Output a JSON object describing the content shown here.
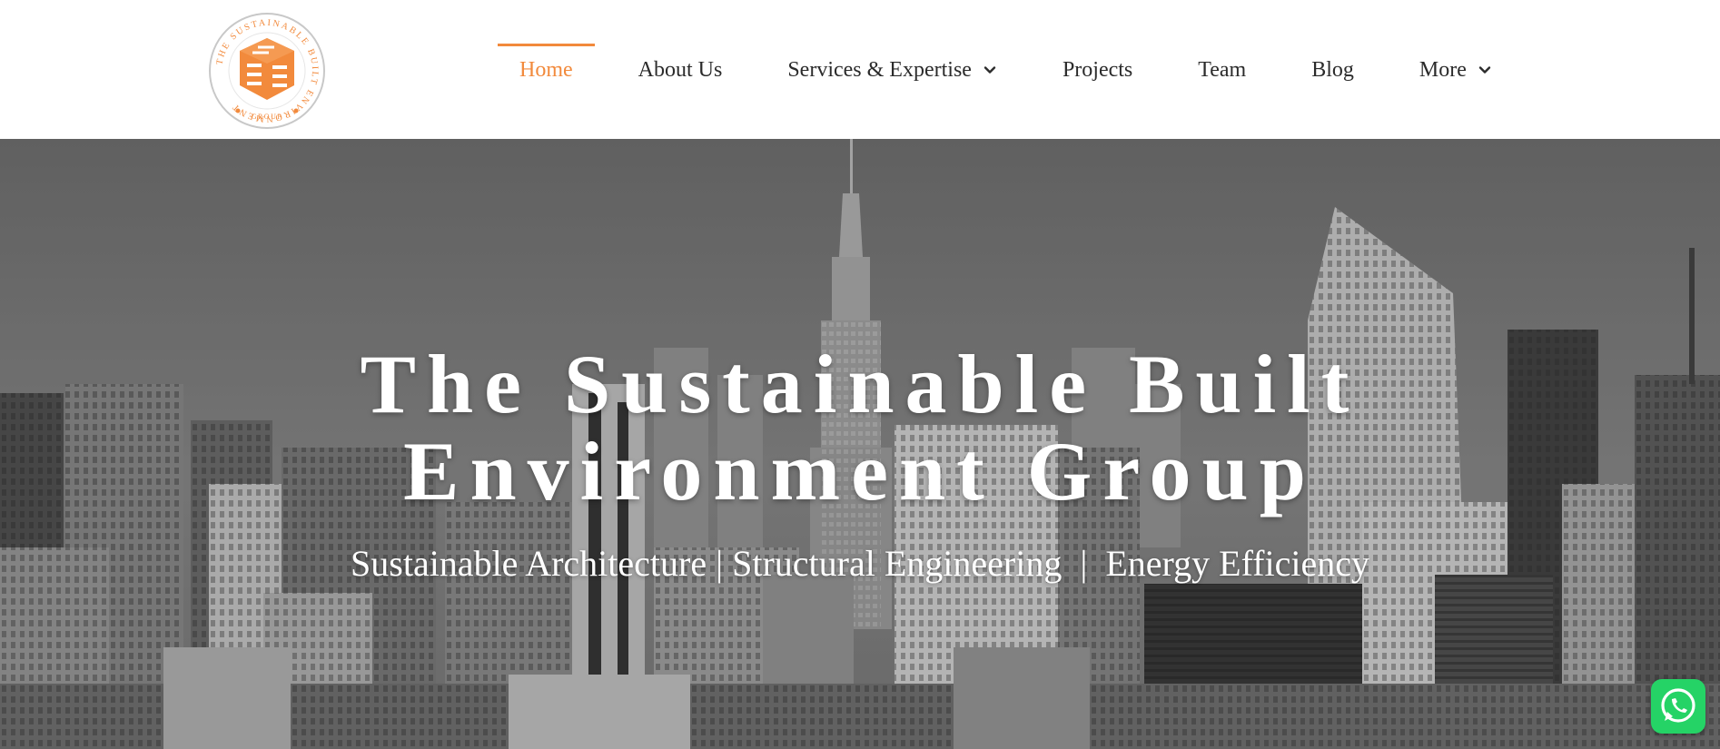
{
  "brand": {
    "logo_ring_text": "THE SUSTAINABLE BUILT ENVIRONMENT",
    "logo_group_text": "GROUP",
    "accent": "#f28a3c"
  },
  "nav": {
    "items": [
      {
        "label": "Home",
        "active": true
      },
      {
        "label": "About Us"
      },
      {
        "label": "Services & Expertise",
        "has_dropdown": true
      },
      {
        "label": "Projects"
      },
      {
        "label": "Team"
      },
      {
        "label": "Blog"
      },
      {
        "label": "More",
        "has_dropdown": true
      }
    ]
  },
  "hero": {
    "title_line1": "The Sustainable Built",
    "title_line2": "Environment Group",
    "subtitle": "Sustainable Architecture | Structural Engineering  |  Energy Efficiency",
    "background": "city-skyline-grayscale"
  },
  "floating": {
    "whatsapp_icon": "whatsapp-icon",
    "whatsapp_color": "#25d366"
  }
}
